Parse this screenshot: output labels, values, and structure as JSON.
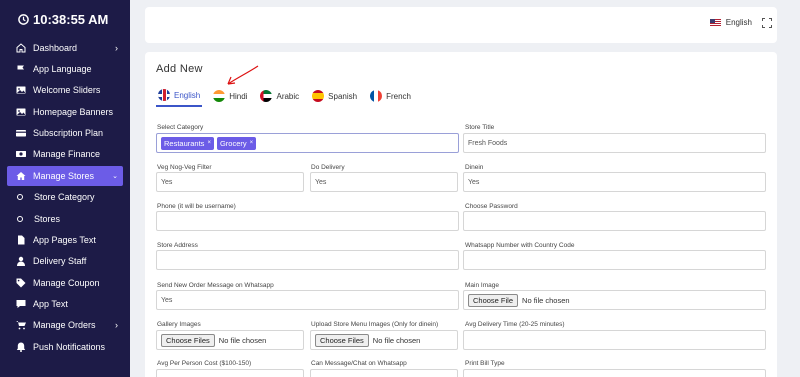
{
  "clock": {
    "time": "10:38:55 AM"
  },
  "sidebar": {
    "items": [
      {
        "label": "Dashboard",
        "icon": "home-icon",
        "has_chevron": true
      },
      {
        "label": "App Language",
        "icon": "flag-icon"
      },
      {
        "label": "Welcome Sliders",
        "icon": "image-icon"
      },
      {
        "label": "Homepage Banners",
        "icon": "image-icon"
      },
      {
        "label": "Subscription Plan",
        "icon": "card-icon"
      },
      {
        "label": "Manage Finance",
        "icon": "money-icon"
      },
      {
        "label": "Manage Stores",
        "icon": "store-icon",
        "active": true
      },
      {
        "label": "Store Category",
        "sub": true
      },
      {
        "label": "Stores",
        "sub": true
      },
      {
        "label": "App Pages Text",
        "icon": "file-icon"
      },
      {
        "label": "Delivery Staff",
        "icon": "user-icon"
      },
      {
        "label": "Manage Coupon",
        "icon": "tag-icon"
      },
      {
        "label": "App Text",
        "icon": "comment-icon"
      },
      {
        "label": "Manage Orders",
        "icon": "cart-icon",
        "has_chevron": true
      },
      {
        "label": "Push Notifications",
        "icon": "bell-icon"
      }
    ]
  },
  "topbar": {
    "language": "English"
  },
  "card": {
    "title": "Add New",
    "tabs": [
      {
        "label": "English",
        "flag": "uk-flag-icon"
      },
      {
        "label": "Hindi",
        "flag": "india-flag-icon"
      },
      {
        "label": "Arabic",
        "flag": "uae-flag-icon"
      },
      {
        "label": "Spanish",
        "flag": "spain-flag-icon"
      },
      {
        "label": "French",
        "flag": "france-flag-icon"
      }
    ]
  },
  "form": {
    "select_category": {
      "label": "Select Category",
      "chips": [
        "Restaurants",
        "Grocery"
      ],
      "remove_glyph": "×"
    },
    "store_title": {
      "label": "Store Title",
      "value": "Fresh Foods"
    },
    "veg_filter": {
      "label": "Veg Nog-Veg Filter",
      "value": "Yes"
    },
    "do_delivery": {
      "label": "Do Delivery",
      "value": "Yes"
    },
    "dinein": {
      "label": "Dinein",
      "value": "Yes"
    },
    "phone": {
      "label": "Phone (it will be username)",
      "value": ""
    },
    "password": {
      "label": "Choose Password",
      "value": ""
    },
    "store_address": {
      "label": "Store Address",
      "value": ""
    },
    "whatsapp_number": {
      "label": "Whatsapp Number with Country Code",
      "value": ""
    },
    "send_whatsapp": {
      "label": "Send New Order Message on Whatsapp",
      "value": "Yes"
    },
    "main_image": {
      "label": "Main Image",
      "button": "Choose File",
      "status": "No file chosen"
    },
    "gallery_images": {
      "label": "Gallery Images",
      "button": "Choose Files",
      "status": "No file chosen"
    },
    "menu_images": {
      "label": "Upload Store Menu Images (Only for dinein)",
      "button": "Choose Files",
      "status": "No file chosen"
    },
    "avg_delivery": {
      "label": "Avg Delivery Time (20-25 minutes)",
      "value": ""
    },
    "avg_cost": {
      "label": "Avg Per Person Cost ($100-150)"
    },
    "can_message": {
      "label": "Can Message/Chat on Whatsapp"
    },
    "print_bill": {
      "label": "Print Bill Type"
    }
  }
}
